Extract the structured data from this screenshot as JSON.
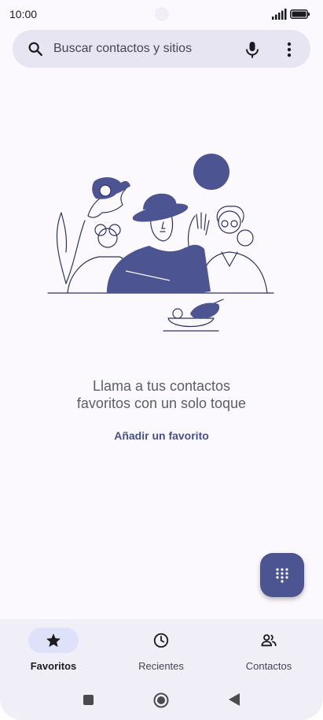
{
  "status_bar": {
    "time": "10:00"
  },
  "search": {
    "placeholder": "Buscar contactos y sitios"
  },
  "empty_state": {
    "title_line1": "Llama a tus contactos",
    "title_line2": "favoritos con un solo toque",
    "action_label": "Añadir un favorito"
  },
  "bottom_nav": {
    "items": [
      {
        "label": "Favoritos",
        "icon": "star-icon",
        "active": true
      },
      {
        "label": "Recientes",
        "icon": "clock-icon",
        "active": false
      },
      {
        "label": "Contactos",
        "icon": "people-icon",
        "active": false
      }
    ]
  },
  "colors": {
    "accent": "#4c5592",
    "background": "#fbf8fe",
    "search_bar": "#e7e5f2",
    "nav_bar": "#f0eef7",
    "active_pill": "#dde1f9"
  }
}
